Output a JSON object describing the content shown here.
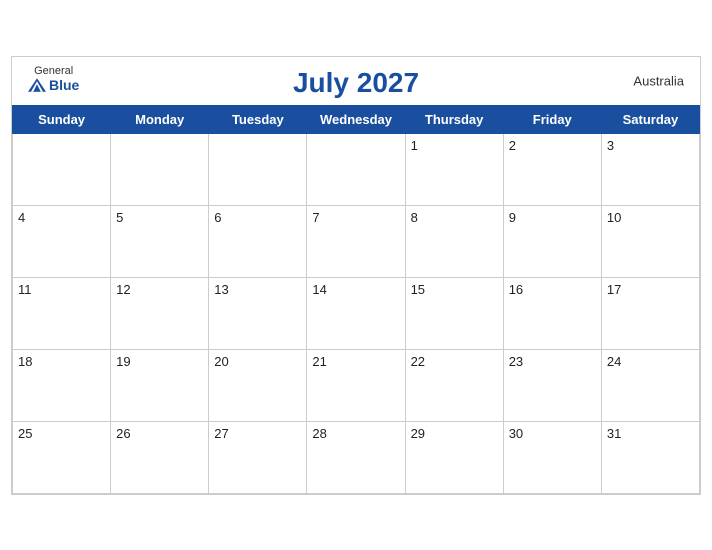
{
  "header": {
    "title": "July 2027",
    "country": "Australia",
    "logo": {
      "line1": "General",
      "line2": "Blue"
    }
  },
  "days_of_week": [
    "Sunday",
    "Monday",
    "Tuesday",
    "Wednesday",
    "Thursday",
    "Friday",
    "Saturday"
  ],
  "weeks": [
    [
      null,
      null,
      null,
      null,
      1,
      2,
      3
    ],
    [
      4,
      5,
      6,
      7,
      8,
      9,
      10
    ],
    [
      11,
      12,
      13,
      14,
      15,
      16,
      17
    ],
    [
      18,
      19,
      20,
      21,
      22,
      23,
      24
    ],
    [
      25,
      26,
      27,
      28,
      29,
      30,
      31
    ]
  ],
  "colors": {
    "header_bg": "#1a4fa0",
    "header_text": "#ffffff",
    "title_color": "#1a4fa0"
  }
}
